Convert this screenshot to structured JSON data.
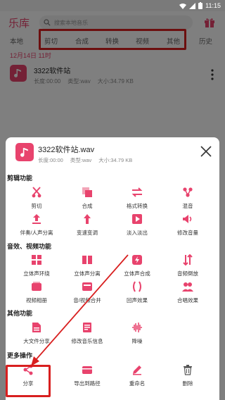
{
  "status_bar": {
    "time": "11:15"
  },
  "app": {
    "title": "乐库",
    "search_placeholder": "搜索本地音乐",
    "tabs": [
      "本地",
      "剪切",
      "合成",
      "转换",
      "视频",
      "其他",
      "历史"
    ],
    "date": "12月14日  11时",
    "track": {
      "name": "3322软件站",
      "duration": "长度:00:00",
      "type": "类型:wav",
      "size": "大小:34.79 KB"
    }
  },
  "sheet": {
    "file_name": "3322软件站.wav",
    "duration": "长度:00:00",
    "type": "类型:wav",
    "size": "大小:34.79 KB",
    "sections": [
      {
        "title": "剪辑功能",
        "items": [
          {
            "label": "剪切",
            "icon": "scissors-icon"
          },
          {
            "label": "合成",
            "icon": "merge-icon"
          },
          {
            "label": "格式转换",
            "icon": "convert-icon"
          },
          {
            "label": "混音",
            "icon": "mix-icon"
          },
          {
            "label": "伴奏/人声分离",
            "icon": "upload-icon"
          },
          {
            "label": "变速变调",
            "icon": "speed-icon"
          },
          {
            "label": "淡入淡出",
            "icon": "fade-icon"
          },
          {
            "label": "修改音量",
            "icon": "volume-icon"
          }
        ]
      },
      {
        "title": "音效、视频功能",
        "items": [
          {
            "label": "立体声环绕",
            "icon": "surround-icon"
          },
          {
            "label": "立体声分离",
            "icon": "stereo-split-icon"
          },
          {
            "label": "立体声合成",
            "icon": "stereo-merge-icon"
          },
          {
            "label": "音频倒放",
            "icon": "reverse-icon"
          },
          {
            "label": "视频相册",
            "icon": "album-icon"
          },
          {
            "label": "音/视频合并",
            "icon": "av-merge-icon"
          },
          {
            "label": "回声效果",
            "icon": "echo-icon"
          },
          {
            "label": "合唱效果",
            "icon": "chorus-icon"
          }
        ]
      },
      {
        "title": "其他功能",
        "items": [
          {
            "label": "大文件分享",
            "icon": "big-file-icon"
          },
          {
            "label": "修改音乐信息",
            "icon": "edit-info-icon"
          },
          {
            "label": "降噪",
            "icon": "denoise-icon"
          }
        ]
      },
      {
        "title": "更多操作",
        "items": [
          {
            "label": "分享",
            "icon": "share-icon"
          },
          {
            "label": "导出到路径",
            "icon": "export-icon"
          },
          {
            "label": "重命名",
            "icon": "rename-icon"
          },
          {
            "label": "删除",
            "icon": "trash-icon"
          }
        ]
      }
    ]
  },
  "colors": {
    "accent": "#e8436d",
    "highlight": "#d81f1f"
  }
}
